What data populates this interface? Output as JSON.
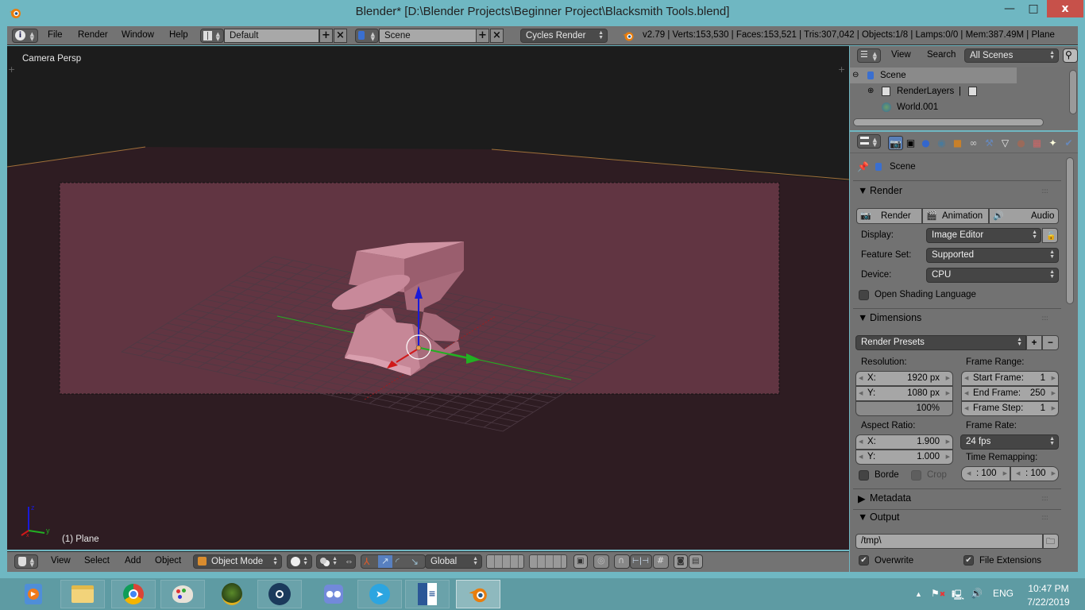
{
  "window": {
    "title": "Blender* [D:\\Blender Projects\\Beginner Project\\Blacksmith Tools.blend]",
    "minimize_icon": "minimize-icon",
    "maximize_icon": "maximize-icon",
    "close_label": "x"
  },
  "info_header": {
    "editor_icon": "info-icon",
    "menus": [
      "File",
      "Render",
      "Window",
      "Help"
    ],
    "screen_layout": "Default",
    "scene": "Scene",
    "render_engine": "Cycles Render",
    "stats": "v2.79 | Verts:153,530 | Faces:153,521 | Tris:307,042 | Objects:1/8 | Lamps:0/0 | Mem:387.49M | Plane"
  },
  "viewport": {
    "view_name": "Camera Persp",
    "object_info": "(1) Plane",
    "axis_labels": {
      "x": "x",
      "y": "y",
      "z": "z"
    },
    "colors": {
      "background": "#1c1c1c",
      "floor": "#2e1c22",
      "camera_frame": "#613542",
      "anvil": "#c98a9a",
      "x_axis": "#d01818",
      "y_axis": "#22b022",
      "z_axis": "#1a1ad8",
      "horizon": "#a0703a"
    }
  },
  "view3d_header": {
    "editor_icon": "3d-view-icon",
    "menus": [
      "View",
      "Select",
      "Add",
      "Object"
    ],
    "mode": "Object Mode",
    "transform_orientation": "Global"
  },
  "outliner": {
    "menus": [
      "View",
      "Search"
    ],
    "filter": "All Scenes",
    "tree": [
      {
        "label": "Scene",
        "icon": "scene-icon",
        "expanded": true
      },
      {
        "label": "RenderLayers",
        "icon": "render-layers-icon"
      },
      {
        "label": "World.001",
        "icon": "world-icon"
      }
    ]
  },
  "properties": {
    "context_label": "Scene",
    "tabs": [
      "render",
      "render-layers",
      "scene",
      "world",
      "object",
      "constraints",
      "modifiers",
      "data",
      "material",
      "texture",
      "particles",
      "physics"
    ],
    "render_panel": {
      "title": "Render",
      "buttons": [
        "Render",
        "Animation",
        "Audio"
      ],
      "display_label": "Display:",
      "display_value": "Image Editor",
      "feature_set_label": "Feature Set:",
      "feature_set_value": "Supported",
      "device_label": "Device:",
      "device_value": "CPU",
      "osl_label": "Open Shading Language",
      "osl_checked": false
    },
    "dimensions_panel": {
      "title": "Dimensions",
      "presets": "Render Presets",
      "resolution_label": "Resolution:",
      "res_x_label": "X:",
      "res_x": "1920 px",
      "res_y_label": "Y:",
      "res_y": "1080 px",
      "res_pct": "100%",
      "frame_range_label": "Frame Range:",
      "start_label": "Start Frame:",
      "start": "1",
      "end_label": "End Frame:",
      "end": "250",
      "step_label": "Frame Step:",
      "step": "1",
      "aspect_label": "Aspect Ratio:",
      "aspect_x_label": "X:",
      "aspect_x": "1.900",
      "aspect_y_label": "Y:",
      "aspect_y": "1.000",
      "frame_rate_label": "Frame Rate:",
      "frame_rate": "24 fps",
      "time_remap_label": "Time Remapping:",
      "remap_old": ": 100",
      "remap_new": ": 100",
      "border_label": "Borde",
      "crop_label": "Crop"
    },
    "metadata_panel": {
      "title": "Metadata"
    },
    "output_panel": {
      "title": "Output",
      "path": "/tmp\\",
      "overwrite_label": "Overwrite",
      "overwrite_checked": true,
      "file_ext_label": "File Extensions",
      "file_ext_checked": true
    }
  },
  "taskbar": {
    "apps": [
      "Windows Media Player",
      "File Explorer",
      "Google Chrome",
      "Paint",
      "Google Earth",
      "Steam",
      "Discord",
      "Telegram",
      "Microsoft Word",
      "Blender"
    ],
    "active_app": "Blender",
    "language": "ENG",
    "time": "10:47 PM",
    "date": "7/22/2019"
  }
}
